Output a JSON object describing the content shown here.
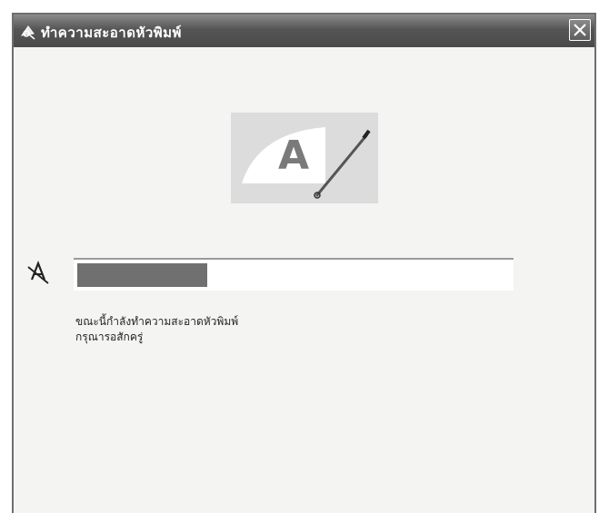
{
  "window": {
    "title": "ทำความสะอาดหัวพิมพ์",
    "icon": "printer-cleaning-icon",
    "close_icon": "close-icon"
  },
  "hero": {
    "icon": "cleaning-brush-icon",
    "letter": "A"
  },
  "progress": {
    "icon": "cleaning-status-icon",
    "percent": 30,
    "fill_color": "#707070"
  },
  "message": {
    "line1": "ขณะนี้กำลังทำความสะอาดหัวพิมพ์",
    "line2": "กรุณารอสักครู่"
  }
}
